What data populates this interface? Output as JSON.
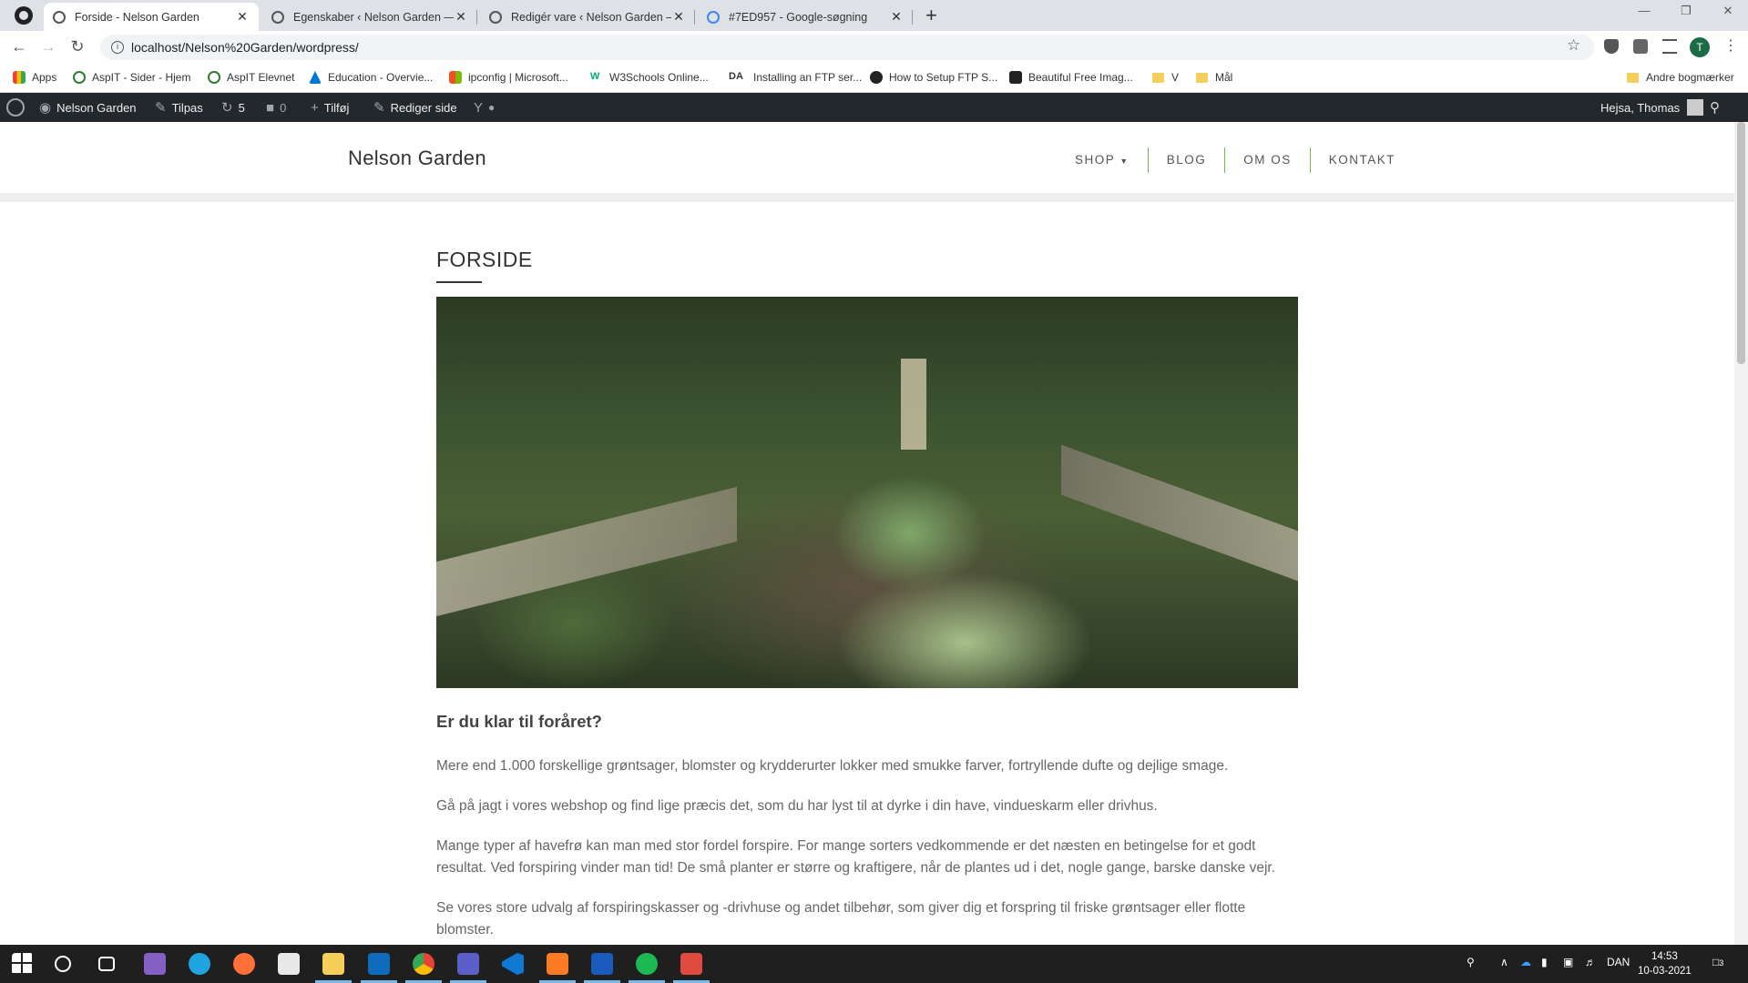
{
  "browser": {
    "tabs": [
      {
        "title": "Forside - Nelson Garden",
        "active": true
      },
      {
        "title": "Egenskaber ‹ Nelson Garden — W",
        "active": false
      },
      {
        "title": "Redigér vare ‹ Nelson Garden —",
        "active": false
      },
      {
        "title": "#7ED957 - Google-søgning",
        "active": false
      }
    ],
    "new_tab": "+",
    "close": "✕",
    "url": "localhost/Nelson%20Garden/wordpress/",
    "profile_initial": "T",
    "bookmarks": [
      {
        "label": "Apps"
      },
      {
        "label": "AspIT - Sider - Hjem"
      },
      {
        "label": "AspIT Elevnet"
      },
      {
        "label": "Education - Overvie..."
      },
      {
        "label": "ipconfig | Microsoft..."
      },
      {
        "label": "W3Schools Online..."
      },
      {
        "label": "Installing an FTP ser..."
      },
      {
        "label": "How to Setup FTP S..."
      },
      {
        "label": "Beautiful Free Imag..."
      },
      {
        "label": "V"
      },
      {
        "label": "Mål"
      }
    ],
    "other_bookmarks": "Andre bogmærker"
  },
  "adminbar": {
    "site": "Nelson Garden",
    "customize": "Tilpas",
    "updates": "5",
    "comments": "0",
    "new": "Tilføj",
    "edit": "Rediger side",
    "greeting": "Hejsa, Thomas"
  },
  "site": {
    "title": "Nelson Garden",
    "menu": [
      "SHOP",
      "BLOG",
      "OM OS",
      "KONTAKT"
    ],
    "menu_accent": "#7ab648"
  },
  "page": {
    "title": "FORSIDE",
    "heading": "Er du klar til foråret?",
    "paragraphs": [
      "Mere end 1.000 forskellige grøntsager, blomster og krydderurter lokker med smukke farver, fortryllende dufte og dejlige smage.",
      "Gå på jagt i vores webshop og find lige præcis det, som du har lyst til at dyrke i din have, vindueskarm eller drivhus.",
      "Mange typer af havefrø kan man med stor fordel forspire. For mange sorters vedkommende er det næsten en betingelse for et godt resultat. Ved forspiring vinder man tid! De små planter er større og kraftigere, når de plantes ud i det, nogle gange, barske danske vejr.",
      "Se vores store udvalg af forspiringskasser og -drivhuse og andet tilbehør, som giver dig et forspring til friske grøntsager eller flotte blomster."
    ]
  },
  "taskbar": {
    "language": "DAN",
    "time": "14:53",
    "date": "10-03-2021",
    "notifications": "3"
  }
}
